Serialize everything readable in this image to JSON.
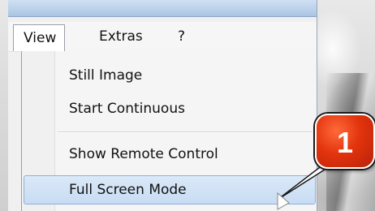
{
  "menubar": {
    "items": [
      {
        "label": "View"
      },
      {
        "label": "Extras"
      },
      {
        "label": "?"
      }
    ]
  },
  "view_menu": {
    "items": [
      {
        "label": "Still Image"
      },
      {
        "label": "Start Continuous"
      },
      {
        "label": "Show Remote Control"
      },
      {
        "label": "Full Screen Mode",
        "highlighted": true
      }
    ]
  },
  "callout": {
    "number": "1",
    "color": "#e3340d"
  },
  "colors": {
    "highlight": "#c7dcf3",
    "highlight_border": "#8fb0d8"
  }
}
